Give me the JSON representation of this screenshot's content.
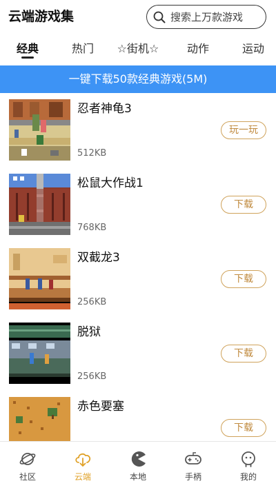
{
  "header": {
    "title": "云端游戏集",
    "search_placeholder": "搜索上万款游戏"
  },
  "tabs": [
    "经典",
    "热门",
    "☆街机☆",
    "动作",
    "运动"
  ],
  "active_tab": "经典",
  "banner": {
    "text": "一键下载50款经典游戏(5M)"
  },
  "games": [
    {
      "name": "忍者神龟3",
      "size": "512KB",
      "action": "玩一玩"
    },
    {
      "name": "松鼠大作战1",
      "size": "768KB",
      "action": "下载"
    },
    {
      "name": "双截龙3",
      "size": "256KB",
      "action": "下载"
    },
    {
      "name": "脱狱",
      "size": "256KB",
      "action": "下载"
    },
    {
      "name": "赤色要塞",
      "size": "",
      "action": "下载"
    }
  ],
  "bottom_nav": [
    {
      "label": "社区",
      "icon": "planet-icon"
    },
    {
      "label": "云端",
      "icon": "cloud-download-icon",
      "active": true
    },
    {
      "label": "本地",
      "icon": "pacman-icon"
    },
    {
      "label": "手柄",
      "icon": "gamepad-icon"
    },
    {
      "label": "我的",
      "icon": "profile-icon"
    }
  ],
  "colors": {
    "banner": "#3d93f5",
    "accent": "#e0a127",
    "button_border": "#cfa25a",
    "button_text": "#c08a3e"
  }
}
